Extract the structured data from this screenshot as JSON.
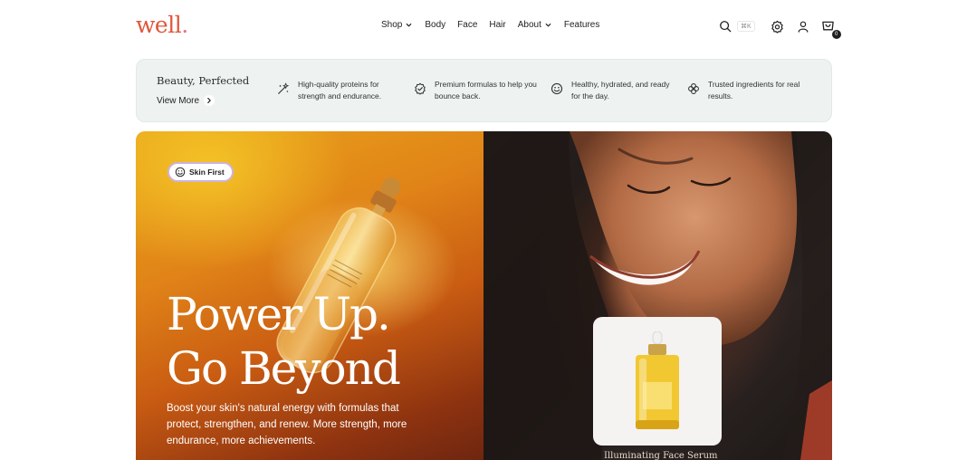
{
  "header": {
    "logo": "well",
    "logo_dot": ".",
    "nav": [
      {
        "label": "Shop",
        "has_dropdown": true
      },
      {
        "label": "Body",
        "has_dropdown": false
      },
      {
        "label": "Face",
        "has_dropdown": false
      },
      {
        "label": "Hair",
        "has_dropdown": false
      },
      {
        "label": "About",
        "has_dropdown": true
      },
      {
        "label": "Features",
        "has_dropdown": false
      }
    ],
    "search_shortcut": "⌘K",
    "cart_count": "0",
    "icons": [
      "search-icon",
      "settings-icon",
      "account-icon",
      "cart-icon"
    ]
  },
  "benefits": {
    "title": "Beauty, Perfected",
    "view_more": "View More",
    "items": [
      {
        "icon": "sparkle-wand-icon",
        "text": "High-quality proteins for strength and endurance."
      },
      {
        "icon": "badge-check-icon",
        "text": "Premium formulas to help you bounce back."
      },
      {
        "icon": "smile-icon",
        "text": "Healthy, hydrated, and ready for the day."
      },
      {
        "icon": "clover-icon",
        "text": "Trusted ingredients for real results."
      }
    ]
  },
  "hero": {
    "badge": "Skin First",
    "headline_line1": "Power Up.",
    "headline_line2": "Go Beyond",
    "body": "Boost your skin's natural energy with formulas that protect, strengthen, and renew. More strength, more endurance, more achievements.",
    "product_name": "Illuminating Face Serum"
  },
  "colors": {
    "logo": "#e0563a",
    "benefits_bg": "#eef3f2",
    "hero_orange": "#e08318",
    "badge_border": "#cbb3e0"
  }
}
